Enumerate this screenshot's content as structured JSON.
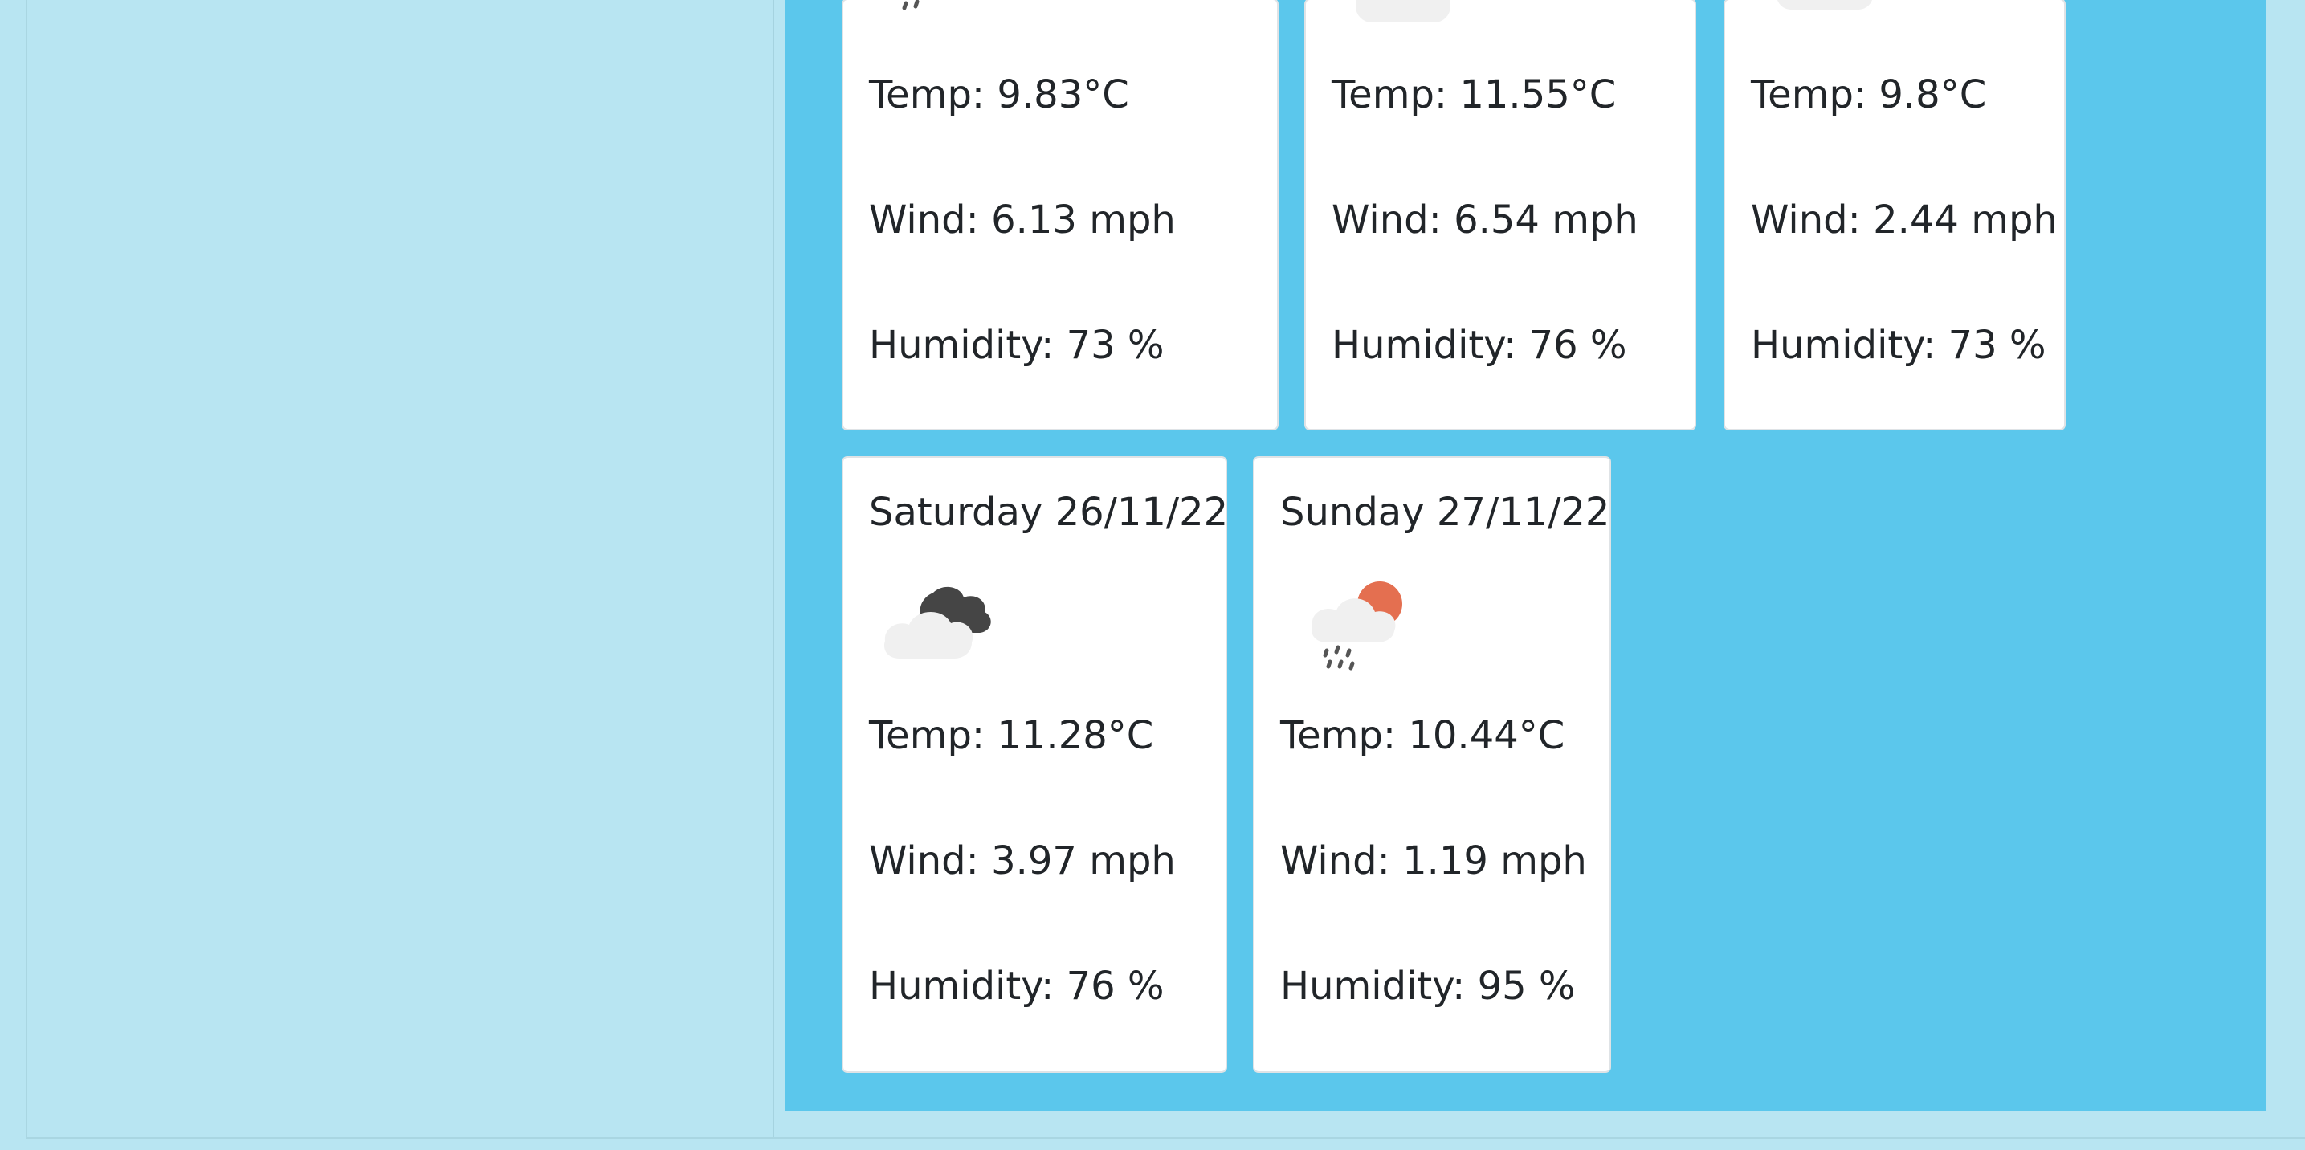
{
  "forecast": {
    "cards": [
      {
        "date": "",
        "icon": "rain-cloud-icon",
        "temp": "Temp: 9.83°C",
        "wind": "Wind: 6.13 mph",
        "humidity": "Humidity: 73 %"
      },
      {
        "date": "",
        "icon": "partly-cloudy-icon",
        "temp": "Temp: 11.55°C",
        "wind": "Wind: 6.54 mph",
        "humidity": "Humidity: 76 %"
      },
      {
        "date": "",
        "icon": "cloud-icon",
        "temp": "Temp: 9.8°C",
        "wind": "Wind: 2.44 mph",
        "humidity": "Humidity: 73 %"
      },
      {
        "date": "Saturday 26/11/22",
        "icon": "broken-clouds-icon",
        "temp": "Temp: 11.28°C",
        "wind": "Wind: 3.97 mph",
        "humidity": "Humidity: 76 %"
      },
      {
        "date": "Sunday 27/11/22",
        "icon": "sun-rain-icon",
        "temp": "Temp: 10.44°C",
        "wind": "Wind: 1.19 mph",
        "humidity": "Humidity: 95 %"
      }
    ]
  },
  "colors": {
    "page_background": "#b8e5f2",
    "forecast_background": "#5bc7ec",
    "card_background": "#ffffff",
    "text": "#212529",
    "sun": "#e46f50",
    "dark_cloud": "#454545",
    "rain": "#555555"
  }
}
